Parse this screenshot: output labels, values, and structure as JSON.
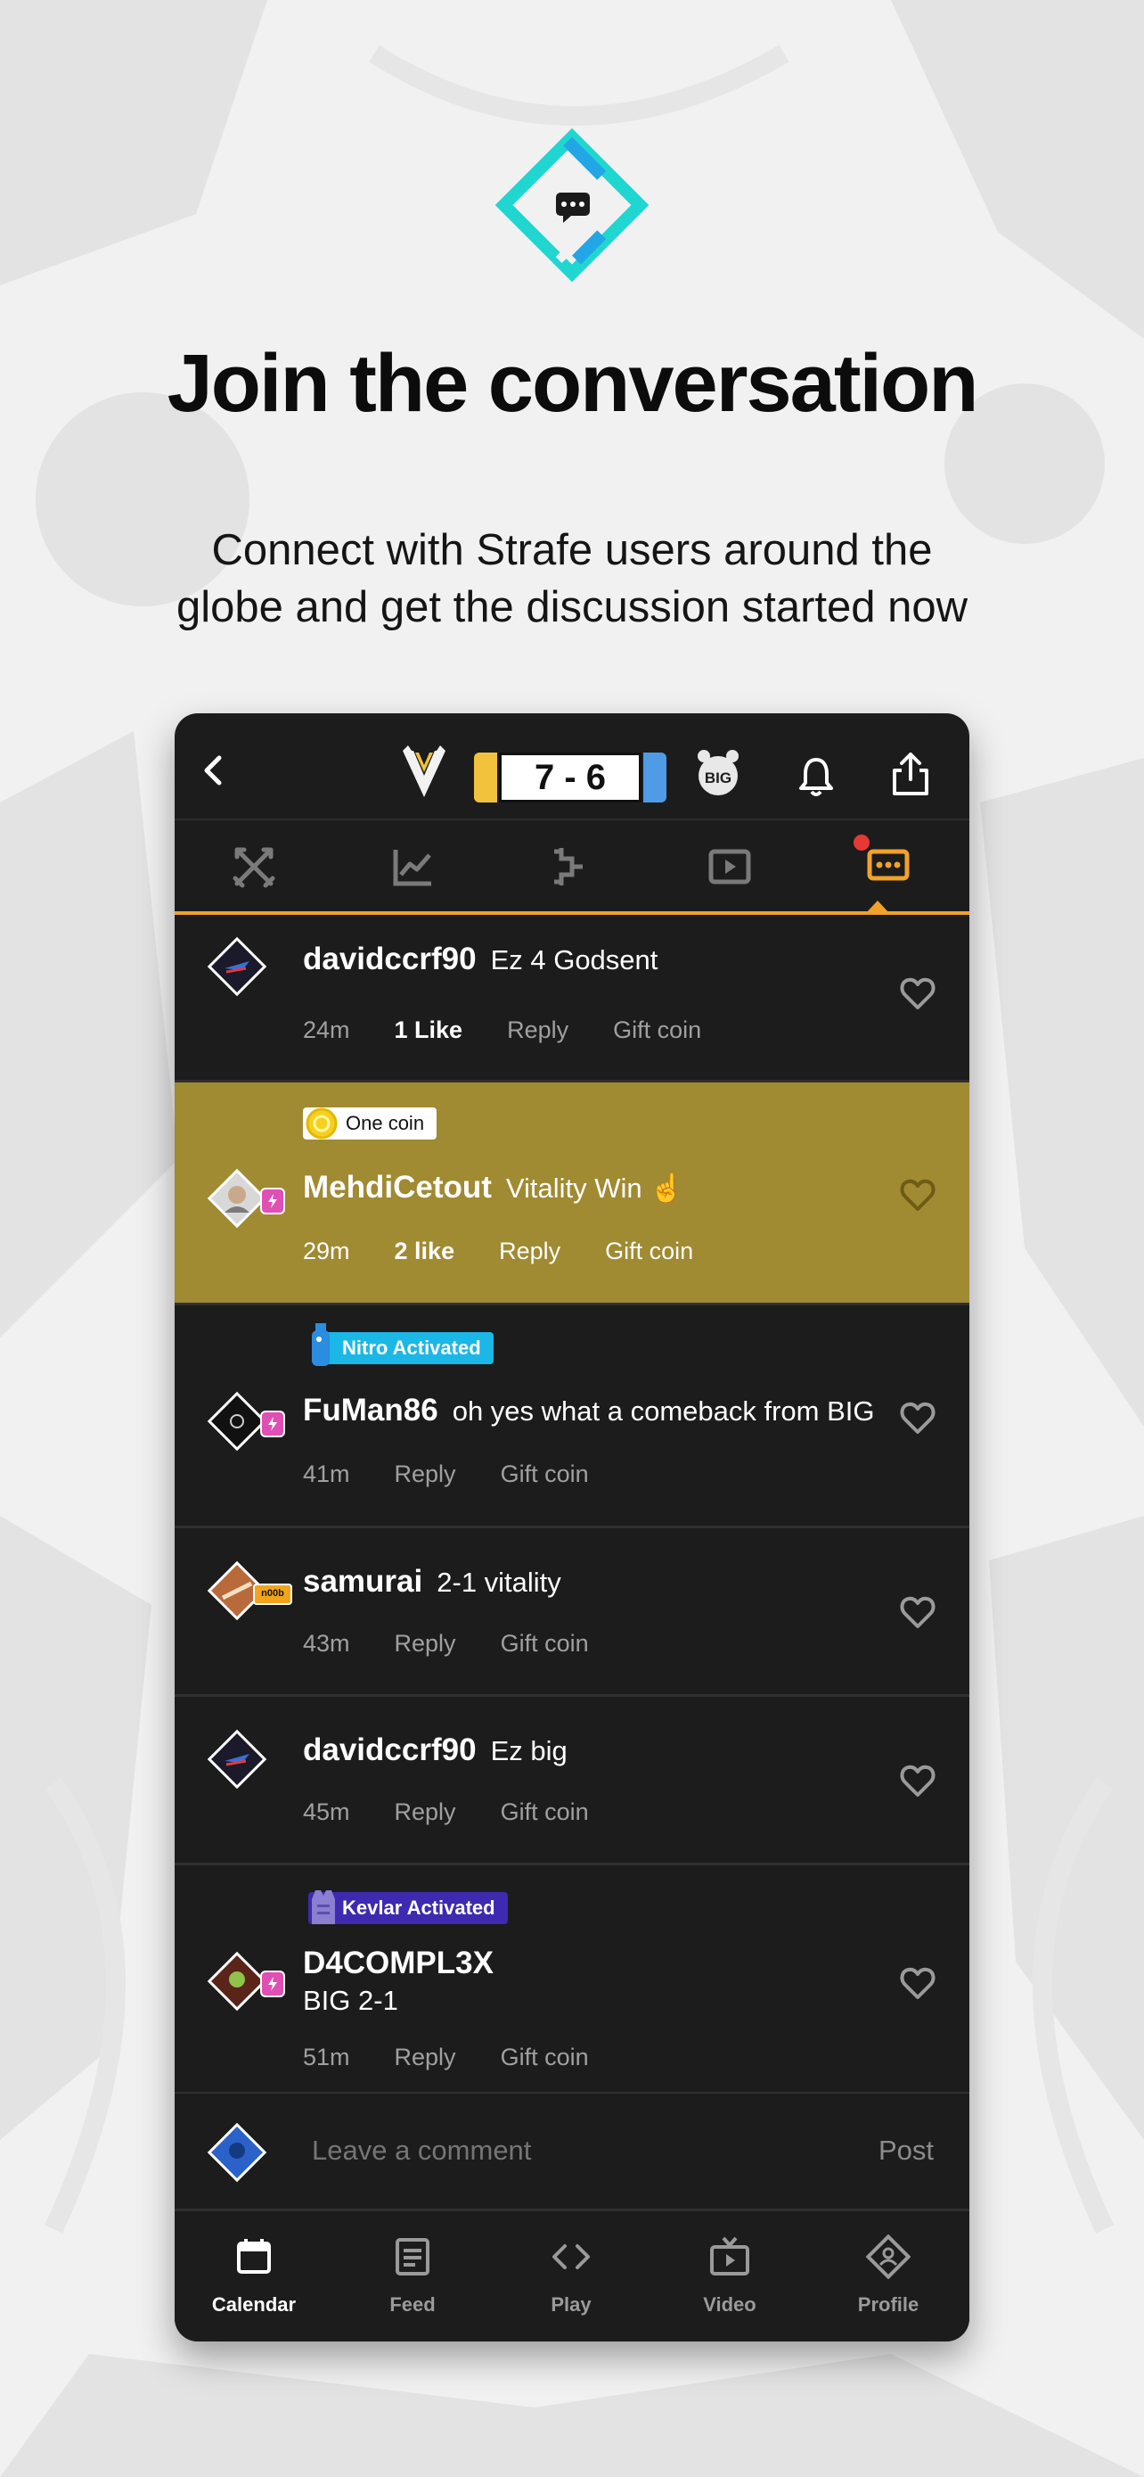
{
  "headline": "Join the conversation",
  "subhead_line1": "Connect with Strafe users around the",
  "subhead_line2": "globe and get the discussion started now",
  "match": {
    "score": "7 - 6"
  },
  "comments": [
    {
      "user": "davidccrf90",
      "message": "Ez 4 Godsent",
      "time": "24m",
      "likes": "1 Like",
      "reply": "Reply",
      "gift": "Gift coin"
    },
    {
      "user": "MehdiCetout",
      "message": "Vitality Win ☝",
      "time": "29m",
      "likes": "2 like",
      "reply": "Reply",
      "gift": "Gift coin",
      "pill": "One coin"
    },
    {
      "user": "FuMan86",
      "message": "oh yes what a comeback from BIG",
      "time": "41m",
      "reply": "Reply",
      "gift": "Gift coin",
      "pill": "Nitro Activated"
    },
    {
      "user": "samurai",
      "message": "2-1 vitality",
      "time": "43m",
      "reply": "Reply",
      "gift": "Gift coin",
      "badge": "n00b"
    },
    {
      "user": "davidccrf90",
      "message": "Ez big",
      "time": "45m",
      "reply": "Reply",
      "gift": "Gift coin"
    },
    {
      "user": "D4COMPL3X",
      "message": "BIG 2-1",
      "time": "51m",
      "reply": "Reply",
      "gift": "Gift coin",
      "pill": "Kevlar Activated"
    }
  ],
  "composer": {
    "placeholder": "Leave a comment",
    "post_label": "Post"
  },
  "nav": [
    {
      "label": "Calendar",
      "icon": "calendar-icon",
      "active": true
    },
    {
      "label": "Feed",
      "icon": "feed-icon"
    },
    {
      "label": "Play",
      "icon": "code-icon"
    },
    {
      "label": "Video",
      "icon": "tv-icon"
    },
    {
      "label": "Profile",
      "icon": "profile-icon"
    }
  ],
  "colors": {
    "accent": "#f0a22a",
    "highlight": "#a08a32",
    "brand": "#1fd6d0"
  }
}
